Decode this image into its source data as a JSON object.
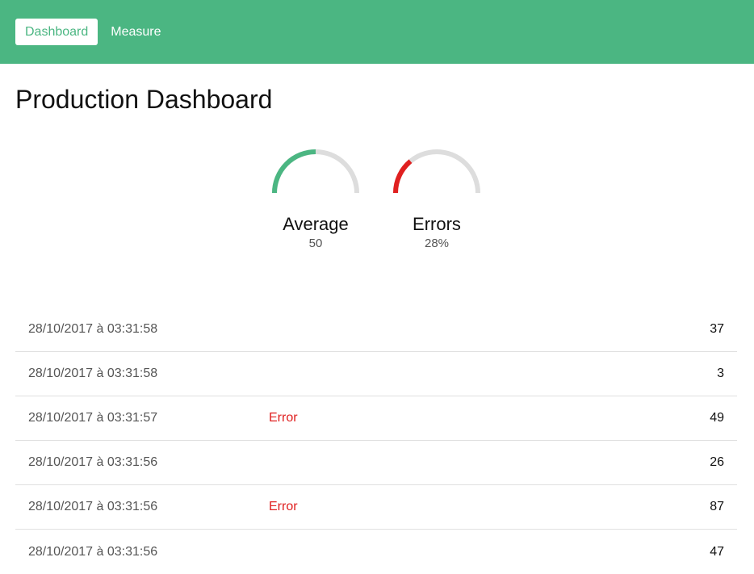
{
  "nav": {
    "items": [
      {
        "label": "Dashboard",
        "active": true
      },
      {
        "label": "Measure",
        "active": false
      }
    ]
  },
  "page": {
    "title": "Production Dashboard"
  },
  "colors": {
    "brand": "#4bb682",
    "error": "#e02020",
    "track": "#dddddd"
  },
  "gauges": [
    {
      "label": "Average",
      "value": "50",
      "fraction": 0.5,
      "color": "#4bb682"
    },
    {
      "label": "Errors",
      "value": "28%",
      "fraction": 0.28,
      "color": "#e02020"
    }
  ],
  "measures": [
    {
      "date": "28/10/2017 à 03:31:58",
      "status": "",
      "value": "37"
    },
    {
      "date": "28/10/2017 à 03:31:58",
      "status": "",
      "value": "3"
    },
    {
      "date": "28/10/2017 à 03:31:57",
      "status": "Error",
      "value": "49"
    },
    {
      "date": "28/10/2017 à 03:31:56",
      "status": "",
      "value": "26"
    },
    {
      "date": "28/10/2017 à 03:31:56",
      "status": "Error",
      "value": "87"
    },
    {
      "date": "28/10/2017 à 03:31:56",
      "status": "",
      "value": "47"
    }
  ]
}
